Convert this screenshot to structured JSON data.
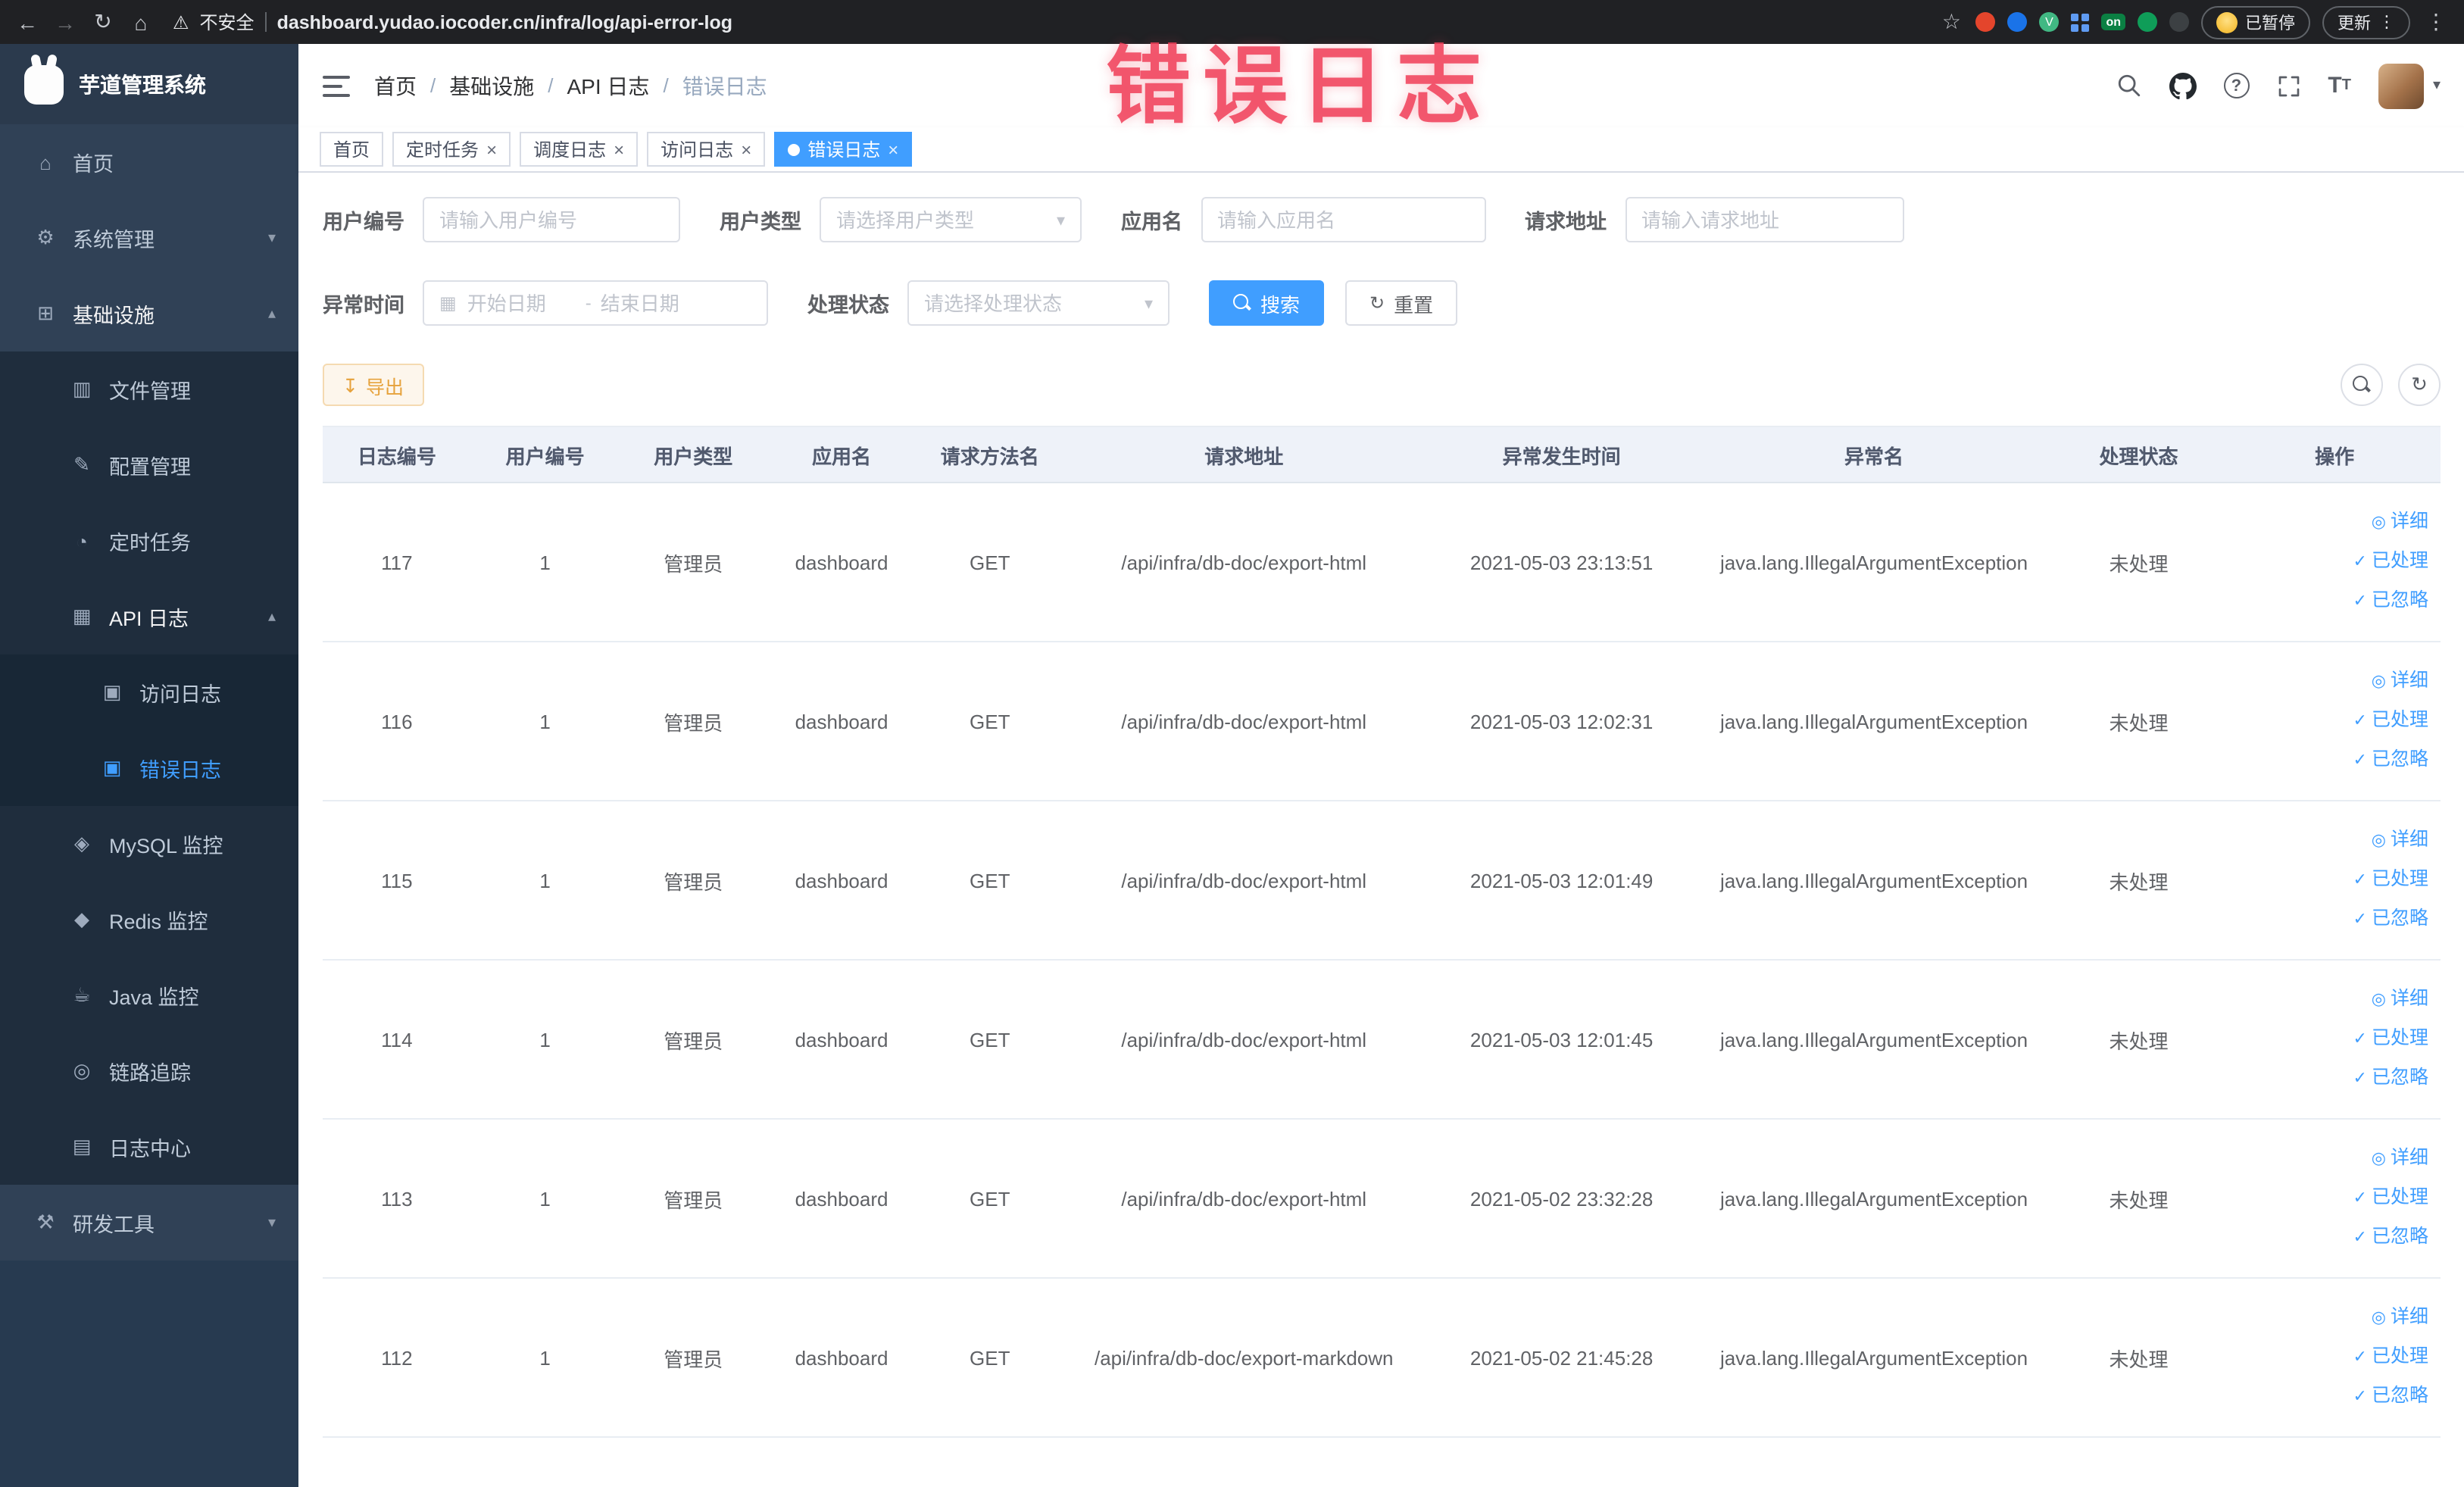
{
  "icons": {
    "back": "←",
    "forward": "→",
    "reload": "↻",
    "home": "⌂",
    "warning": "⚠",
    "star": "☆",
    "kebab": "⋮",
    "vue": "V",
    "close": "×",
    "caret_down": "▾",
    "question": "?",
    "font_big": "T",
    "font_small": "T",
    "calendar": "▦",
    "select_arrow": "▾",
    "download": "↧",
    "refresh": "↻",
    "eye": "◎",
    "check": "✓"
  },
  "browser": {
    "security_warning": "不安全",
    "url": "dashboard.yudao.iocoder.cn/infra/log/api-error-log",
    "extension_badge": "on",
    "paused_badge": "已暂停",
    "update_button": "更新"
  },
  "annotation": {
    "text": "错误日志"
  },
  "sidebar": {
    "logo_title": "芋道管理系统",
    "items": [
      {
        "label": "首页",
        "icon": "home-icon",
        "glyph": "⌂",
        "level": 1
      },
      {
        "label": "系统管理",
        "icon": "gear-icon",
        "glyph": "⚙",
        "level": 1,
        "chevron": "▾"
      },
      {
        "label": "基础设施",
        "icon": "infra-icon",
        "glyph": "⊞",
        "level": 1,
        "chevron": "▴",
        "bright": true
      },
      {
        "label": "文件管理",
        "icon": "file-icon",
        "glyph": "▥",
        "level": 2
      },
      {
        "label": "配置管理",
        "icon": "config-icon",
        "glyph": "✎",
        "level": 2
      },
      {
        "label": "定时任务",
        "icon": "timer-icon",
        "glyph": "◔",
        "level": 2
      },
      {
        "label": "API 日志",
        "icon": "api-log-icon",
        "glyph": "▦",
        "level": 2,
        "chevron": "▴",
        "bright": true
      },
      {
        "label": "访问日志",
        "icon": "access-log-icon",
        "glyph": "▣",
        "level": 3
      },
      {
        "label": "错误日志",
        "icon": "error-log-icon",
        "glyph": "▣",
        "level": 3,
        "active": true
      },
      {
        "label": "MySQL 监控",
        "icon": "mysql-icon",
        "glyph": "◈",
        "level": 2
      },
      {
        "label": "Redis 监控",
        "icon": "redis-icon",
        "glyph": "◆",
        "level": 2
      },
      {
        "label": "Java 监控",
        "icon": "java-icon",
        "glyph": "☕",
        "level": 2
      },
      {
        "label": "链路追踪",
        "icon": "trace-icon",
        "glyph": "◎",
        "level": 2
      },
      {
        "label": "日志中心",
        "icon": "log-center-icon",
        "glyph": "▤",
        "level": 2
      },
      {
        "label": "研发工具",
        "icon": "tools-icon",
        "glyph": "⚒",
        "level": 1,
        "chevron": "▾"
      }
    ]
  },
  "breadcrumb": {
    "separator": "/",
    "items": [
      "首页",
      "基础设施",
      "API 日志",
      "错误日志"
    ]
  },
  "tags_bar": {
    "tags": [
      {
        "label": "首页"
      },
      {
        "label": "定时任务",
        "closable": true
      },
      {
        "label": "调度日志",
        "closable": true
      },
      {
        "label": "访问日志",
        "closable": true
      },
      {
        "label": "错误日志",
        "closable": true,
        "active": true
      }
    ]
  },
  "filters": {
    "user_id": {
      "label": "用户编号",
      "placeholder": "请输入用户编号"
    },
    "user_type": {
      "label": "用户类型",
      "placeholder": "请选择用户类型"
    },
    "app_name": {
      "label": "应用名",
      "placeholder": "请输入应用名"
    },
    "request_url": {
      "label": "请求地址",
      "placeholder": "请输入请求地址"
    },
    "exception_time": {
      "label": "异常时间",
      "start_placeholder": "开始日期",
      "separator": "-",
      "end_placeholder": "结束日期"
    },
    "process_status": {
      "label": "处理状态",
      "placeholder": "请选择处理状态"
    },
    "search_button": "搜索",
    "reset_button": "重置"
  },
  "toolbar": {
    "export_button": "导出"
  },
  "table": {
    "columns": [
      "日志编号",
      "用户编号",
      "用户类型",
      "应用名",
      "请求方法名",
      "请求地址",
      "异常发生时间",
      "异常名",
      "处理状态",
      "操作"
    ],
    "actions": {
      "detail": "详细",
      "processed": "已处理",
      "ignored": "已忽略"
    },
    "rows": [
      {
        "id": "117",
        "user_id": "1",
        "user_type": "管理员",
        "app": "dashboard",
        "method": "GET",
        "url": "/api/infra/db-doc/export-html",
        "time": "2021-05-03 23:13:51",
        "exception": "java.lang.IllegalArgumentException",
        "status": "未处理"
      },
      {
        "id": "116",
        "user_id": "1",
        "user_type": "管理员",
        "app": "dashboard",
        "method": "GET",
        "url": "/api/infra/db-doc/export-html",
        "time": "2021-05-03 12:02:31",
        "exception": "java.lang.IllegalArgumentException",
        "status": "未处理"
      },
      {
        "id": "115",
        "user_id": "1",
        "user_type": "管理员",
        "app": "dashboard",
        "method": "GET",
        "url": "/api/infra/db-doc/export-html",
        "time": "2021-05-03 12:01:49",
        "exception": "java.lang.IllegalArgumentException",
        "status": "未处理"
      },
      {
        "id": "114",
        "user_id": "1",
        "user_type": "管理员",
        "app": "dashboard",
        "method": "GET",
        "url": "/api/infra/db-doc/export-html",
        "time": "2021-05-03 12:01:45",
        "exception": "java.lang.IllegalArgumentException",
        "status": "未处理"
      },
      {
        "id": "113",
        "user_id": "1",
        "user_type": "管理员",
        "app": "dashboard",
        "method": "GET",
        "url": "/api/infra/db-doc/export-html",
        "time": "2021-05-02 23:32:28",
        "exception": "java.lang.IllegalArgumentException",
        "status": "未处理"
      },
      {
        "id": "112",
        "user_id": "1",
        "user_type": "管理员",
        "app": "dashboard",
        "method": "GET",
        "url": "/api/infra/db-doc/export-markdown",
        "time": "2021-05-02 21:45:28",
        "exception": "java.lang.IllegalArgumentException",
        "status": "未处理"
      }
    ]
  }
}
